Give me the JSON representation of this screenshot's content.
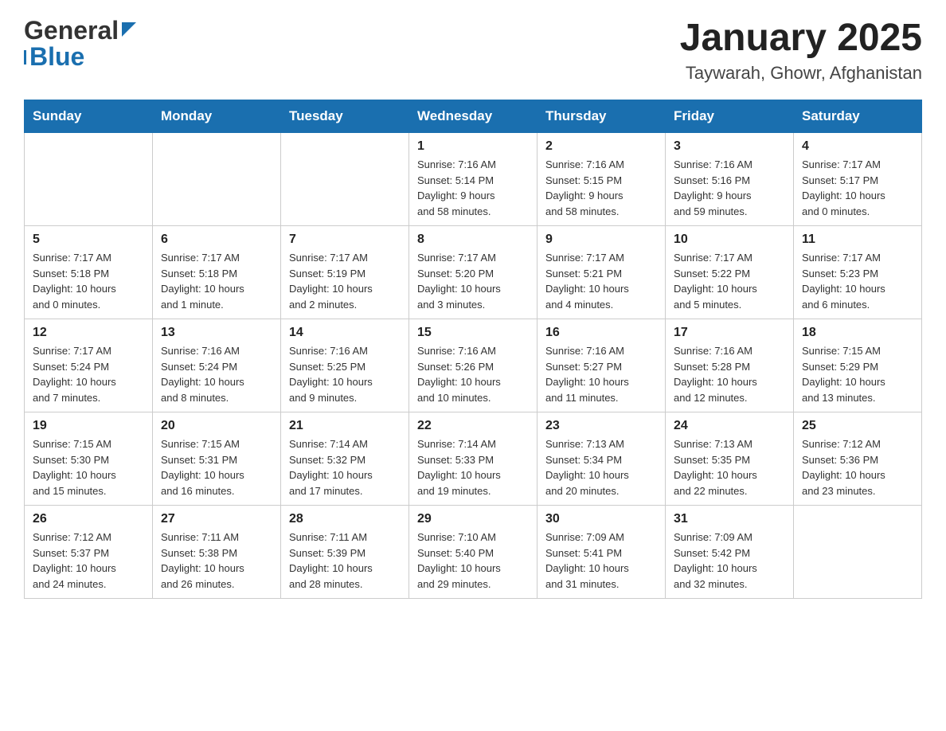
{
  "header": {
    "logo_general": "General",
    "logo_blue": "Blue",
    "month_title": "January 2025",
    "location": "Taywarah, Ghowr, Afghanistan"
  },
  "weekdays": [
    "Sunday",
    "Monday",
    "Tuesday",
    "Wednesday",
    "Thursday",
    "Friday",
    "Saturday"
  ],
  "weeks": [
    [
      {
        "day": "",
        "info": ""
      },
      {
        "day": "",
        "info": ""
      },
      {
        "day": "",
        "info": ""
      },
      {
        "day": "1",
        "info": "Sunrise: 7:16 AM\nSunset: 5:14 PM\nDaylight: 9 hours\nand 58 minutes."
      },
      {
        "day": "2",
        "info": "Sunrise: 7:16 AM\nSunset: 5:15 PM\nDaylight: 9 hours\nand 58 minutes."
      },
      {
        "day": "3",
        "info": "Sunrise: 7:16 AM\nSunset: 5:16 PM\nDaylight: 9 hours\nand 59 minutes."
      },
      {
        "day": "4",
        "info": "Sunrise: 7:17 AM\nSunset: 5:17 PM\nDaylight: 10 hours\nand 0 minutes."
      }
    ],
    [
      {
        "day": "5",
        "info": "Sunrise: 7:17 AM\nSunset: 5:18 PM\nDaylight: 10 hours\nand 0 minutes."
      },
      {
        "day": "6",
        "info": "Sunrise: 7:17 AM\nSunset: 5:18 PM\nDaylight: 10 hours\nand 1 minute."
      },
      {
        "day": "7",
        "info": "Sunrise: 7:17 AM\nSunset: 5:19 PM\nDaylight: 10 hours\nand 2 minutes."
      },
      {
        "day": "8",
        "info": "Sunrise: 7:17 AM\nSunset: 5:20 PM\nDaylight: 10 hours\nand 3 minutes."
      },
      {
        "day": "9",
        "info": "Sunrise: 7:17 AM\nSunset: 5:21 PM\nDaylight: 10 hours\nand 4 minutes."
      },
      {
        "day": "10",
        "info": "Sunrise: 7:17 AM\nSunset: 5:22 PM\nDaylight: 10 hours\nand 5 minutes."
      },
      {
        "day": "11",
        "info": "Sunrise: 7:17 AM\nSunset: 5:23 PM\nDaylight: 10 hours\nand 6 minutes."
      }
    ],
    [
      {
        "day": "12",
        "info": "Sunrise: 7:17 AM\nSunset: 5:24 PM\nDaylight: 10 hours\nand 7 minutes."
      },
      {
        "day": "13",
        "info": "Sunrise: 7:16 AM\nSunset: 5:24 PM\nDaylight: 10 hours\nand 8 minutes."
      },
      {
        "day": "14",
        "info": "Sunrise: 7:16 AM\nSunset: 5:25 PM\nDaylight: 10 hours\nand 9 minutes."
      },
      {
        "day": "15",
        "info": "Sunrise: 7:16 AM\nSunset: 5:26 PM\nDaylight: 10 hours\nand 10 minutes."
      },
      {
        "day": "16",
        "info": "Sunrise: 7:16 AM\nSunset: 5:27 PM\nDaylight: 10 hours\nand 11 minutes."
      },
      {
        "day": "17",
        "info": "Sunrise: 7:16 AM\nSunset: 5:28 PM\nDaylight: 10 hours\nand 12 minutes."
      },
      {
        "day": "18",
        "info": "Sunrise: 7:15 AM\nSunset: 5:29 PM\nDaylight: 10 hours\nand 13 minutes."
      }
    ],
    [
      {
        "day": "19",
        "info": "Sunrise: 7:15 AM\nSunset: 5:30 PM\nDaylight: 10 hours\nand 15 minutes."
      },
      {
        "day": "20",
        "info": "Sunrise: 7:15 AM\nSunset: 5:31 PM\nDaylight: 10 hours\nand 16 minutes."
      },
      {
        "day": "21",
        "info": "Sunrise: 7:14 AM\nSunset: 5:32 PM\nDaylight: 10 hours\nand 17 minutes."
      },
      {
        "day": "22",
        "info": "Sunrise: 7:14 AM\nSunset: 5:33 PM\nDaylight: 10 hours\nand 19 minutes."
      },
      {
        "day": "23",
        "info": "Sunrise: 7:13 AM\nSunset: 5:34 PM\nDaylight: 10 hours\nand 20 minutes."
      },
      {
        "day": "24",
        "info": "Sunrise: 7:13 AM\nSunset: 5:35 PM\nDaylight: 10 hours\nand 22 minutes."
      },
      {
        "day": "25",
        "info": "Sunrise: 7:12 AM\nSunset: 5:36 PM\nDaylight: 10 hours\nand 23 minutes."
      }
    ],
    [
      {
        "day": "26",
        "info": "Sunrise: 7:12 AM\nSunset: 5:37 PM\nDaylight: 10 hours\nand 24 minutes."
      },
      {
        "day": "27",
        "info": "Sunrise: 7:11 AM\nSunset: 5:38 PM\nDaylight: 10 hours\nand 26 minutes."
      },
      {
        "day": "28",
        "info": "Sunrise: 7:11 AM\nSunset: 5:39 PM\nDaylight: 10 hours\nand 28 minutes."
      },
      {
        "day": "29",
        "info": "Sunrise: 7:10 AM\nSunset: 5:40 PM\nDaylight: 10 hours\nand 29 minutes."
      },
      {
        "day": "30",
        "info": "Sunrise: 7:09 AM\nSunset: 5:41 PM\nDaylight: 10 hours\nand 31 minutes."
      },
      {
        "day": "31",
        "info": "Sunrise: 7:09 AM\nSunset: 5:42 PM\nDaylight: 10 hours\nand 32 minutes."
      },
      {
        "day": "",
        "info": ""
      }
    ]
  ]
}
